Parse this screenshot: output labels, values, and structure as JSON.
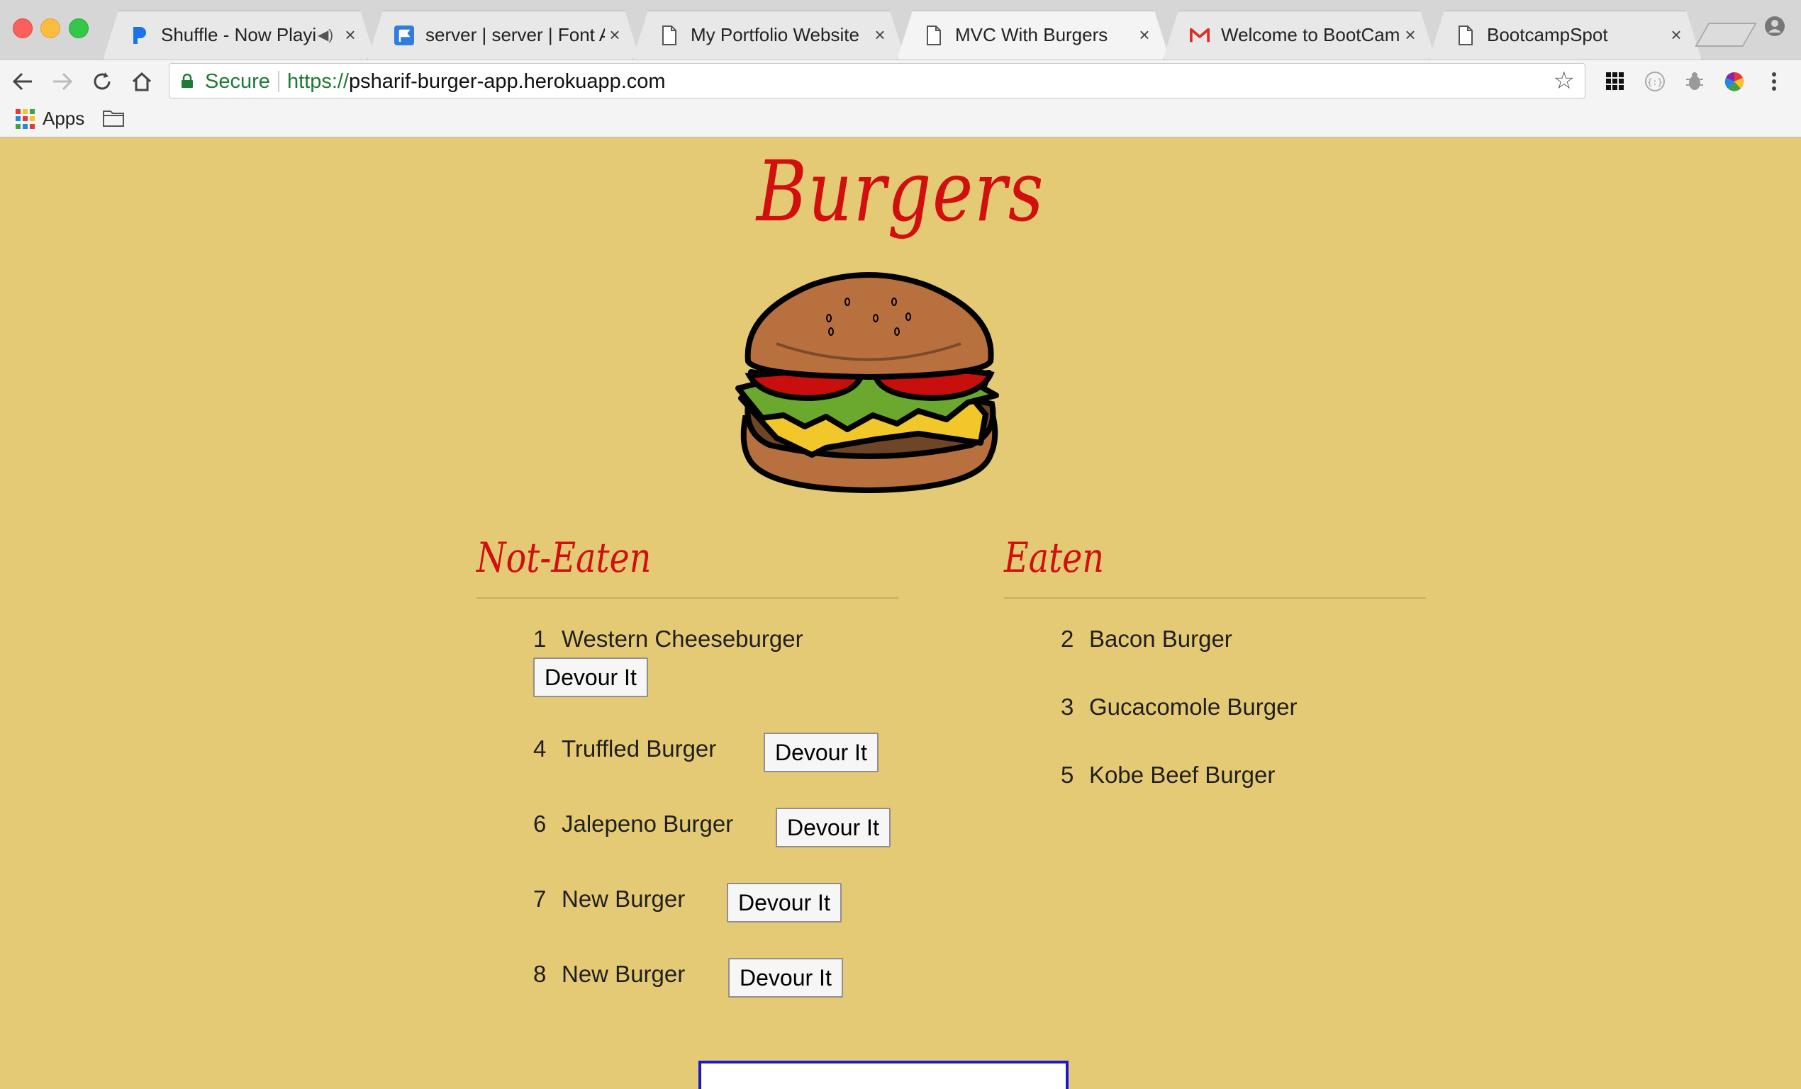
{
  "browser": {
    "tabs": [
      {
        "title": "Shuffle - Now Playin",
        "icon": "pandora-icon",
        "audio": true
      },
      {
        "title": "server | server | Font Aw",
        "icon": "fontawesome-flag-icon",
        "audio": false
      },
      {
        "title": "My Portfolio Website",
        "icon": "document-icon",
        "audio": false
      },
      {
        "title": "MVC With Burgers",
        "icon": "document-icon",
        "audio": false,
        "active": true
      },
      {
        "title": "Welcome to BootCampS",
        "icon": "gmail-icon",
        "audio": false
      },
      {
        "title": "BootcampSpot",
        "icon": "document-icon",
        "audio": false
      }
    ],
    "close_glyph": "×",
    "secure_label": "Secure",
    "url_scheme": "https://",
    "url_host": "psharif-burger-app.herokuapp.com",
    "bookmarks": {
      "apps_label": "Apps"
    }
  },
  "page": {
    "title": "Burgers",
    "not_eaten_heading": "Not-Eaten",
    "eaten_heading": "Eaten",
    "devour_label": "Devour It",
    "not_eaten": [
      {
        "id": "1",
        "name": "Western Cheeseburger"
      },
      {
        "id": "4",
        "name": "Truffled Burger"
      },
      {
        "id": "6",
        "name": "Jalepeno Burger"
      },
      {
        "id": "7",
        "name": "New Burger"
      },
      {
        "id": "8",
        "name": "New Burger"
      }
    ],
    "eaten": [
      {
        "id": "2",
        "name": "Bacon Burger"
      },
      {
        "id": "3",
        "name": "Gucacomole Burger"
      },
      {
        "id": "5",
        "name": "Kobe Beef Burger"
      }
    ]
  },
  "colors": {
    "page_background": "#e5ca75",
    "heading_red": "#d10f0f",
    "secure_green": "#1e7a34",
    "form_border_blue": "#1b19d6"
  }
}
